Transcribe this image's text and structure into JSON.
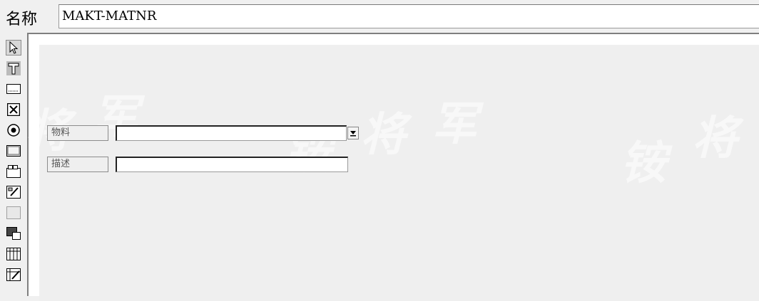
{
  "name_row": {
    "label": "名称",
    "value": "MAKT-MATNR"
  },
  "palette": {
    "tools": [
      {
        "name": "pointer-icon"
      },
      {
        "name": "text-field-icon"
      },
      {
        "name": "input-field-icon"
      },
      {
        "name": "checkbox-icon"
      },
      {
        "name": "radio-button-icon"
      },
      {
        "name": "pushbutton-icon"
      },
      {
        "name": "tabstrip-icon"
      },
      {
        "name": "tabstrip-wizard-icon"
      },
      {
        "name": "box-icon"
      },
      {
        "name": "subscreen-icon"
      },
      {
        "name": "table-control-icon"
      },
      {
        "name": "table-control-wizard-icon"
      }
    ]
  },
  "form": {
    "material_label": "物料",
    "description_label": "描述"
  },
  "watermark": {
    "glyphs": [
      "将",
      "军",
      "铵",
      "将",
      "军",
      "铵",
      "将"
    ]
  }
}
